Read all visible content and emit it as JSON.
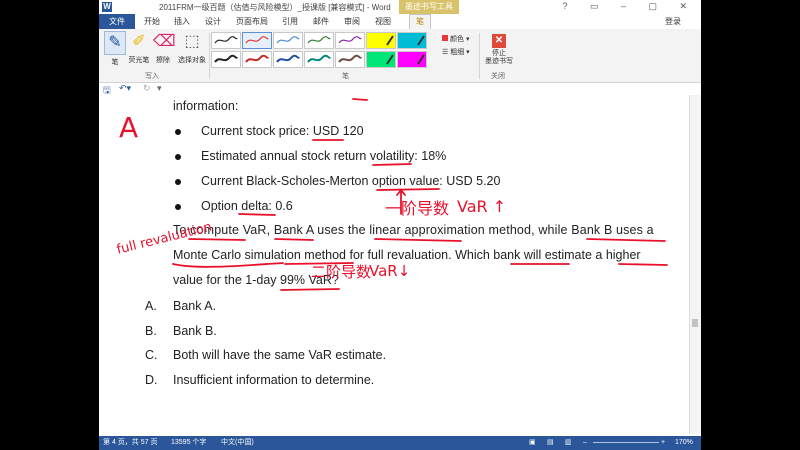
{
  "titlebar": {
    "title": "2011FRM一级百题（估值与风险模型）_授课版 [兼容模式] - Word",
    "context_tab": "墨迹书写工具",
    "login": "登录"
  },
  "tabs": [
    {
      "label": "文件"
    },
    {
      "label": "开始"
    },
    {
      "label": "插入"
    },
    {
      "label": "设计"
    },
    {
      "label": "页面布局"
    },
    {
      "label": "引用"
    },
    {
      "label": "邮件"
    },
    {
      "label": "审阅"
    },
    {
      "label": "视图"
    },
    {
      "label": "笔"
    }
  ],
  "ribbon": {
    "write_group": {
      "label": "写入",
      "buttons": [
        {
          "label": "笔",
          "icon": "pen-icon"
        },
        {
          "label": "荧光笔",
          "icon": "highlighter-icon"
        },
        {
          "label": "擦除",
          "icon": "eraser-icon"
        },
        {
          "label": "选择对象",
          "icon": "select-icon"
        }
      ]
    },
    "pens_group": {
      "label": "笔",
      "color_label": "颜色",
      "thickness_label": "粗细"
    },
    "close_group": {
      "label": "关闭",
      "stop_label": "停止\n墨迹书写"
    },
    "pen_colors": [
      "#222222",
      "#e53935",
      "#4a88d8",
      "#2e7d32",
      "#8e24aa",
      "#ffff00",
      "#00bcd4",
      "#222222",
      "#c62828",
      "#1e4fa0",
      "#00897b",
      "#6d4c41",
      "#00e676",
      "#ff00ff"
    ]
  },
  "document": {
    "intro": "information:",
    "bullets": [
      "Current stock price: USD 120",
      "Estimated annual stock return volatility: 18%",
      "Current Black-Scholes-Merton option value: USD 5.20",
      "Option delta: 0.6"
    ],
    "paragraph": [
      "To compute VaR, Bank A uses the linear approximation method, while Bank B uses a",
      "Monte Carlo simulation method for full revaluation. Which bank will estimate a higher",
      "value for the 1-day 99% VaR?"
    ],
    "options": [
      {
        "letter": "A.",
        "text": "Bank A."
      },
      {
        "letter": "B.",
        "text": "Bank B."
      },
      {
        "letter": "C.",
        "text": "Both will have the same VaR estimate."
      },
      {
        "letter": "D.",
        "text": "Insufficient information to determine."
      }
    ],
    "ink_notes": {
      "big_a": "A",
      "first_order": "一阶导数",
      "var_up": "VaR ↑",
      "full_reval": "full revaluation",
      "second_order": "二阶导数",
      "var_down": "VaR↓"
    }
  },
  "status": {
    "page": "第 4 页，共 57 页",
    "words": "13595 个字",
    "lang": "中文(中国)",
    "zoom": "170%"
  }
}
